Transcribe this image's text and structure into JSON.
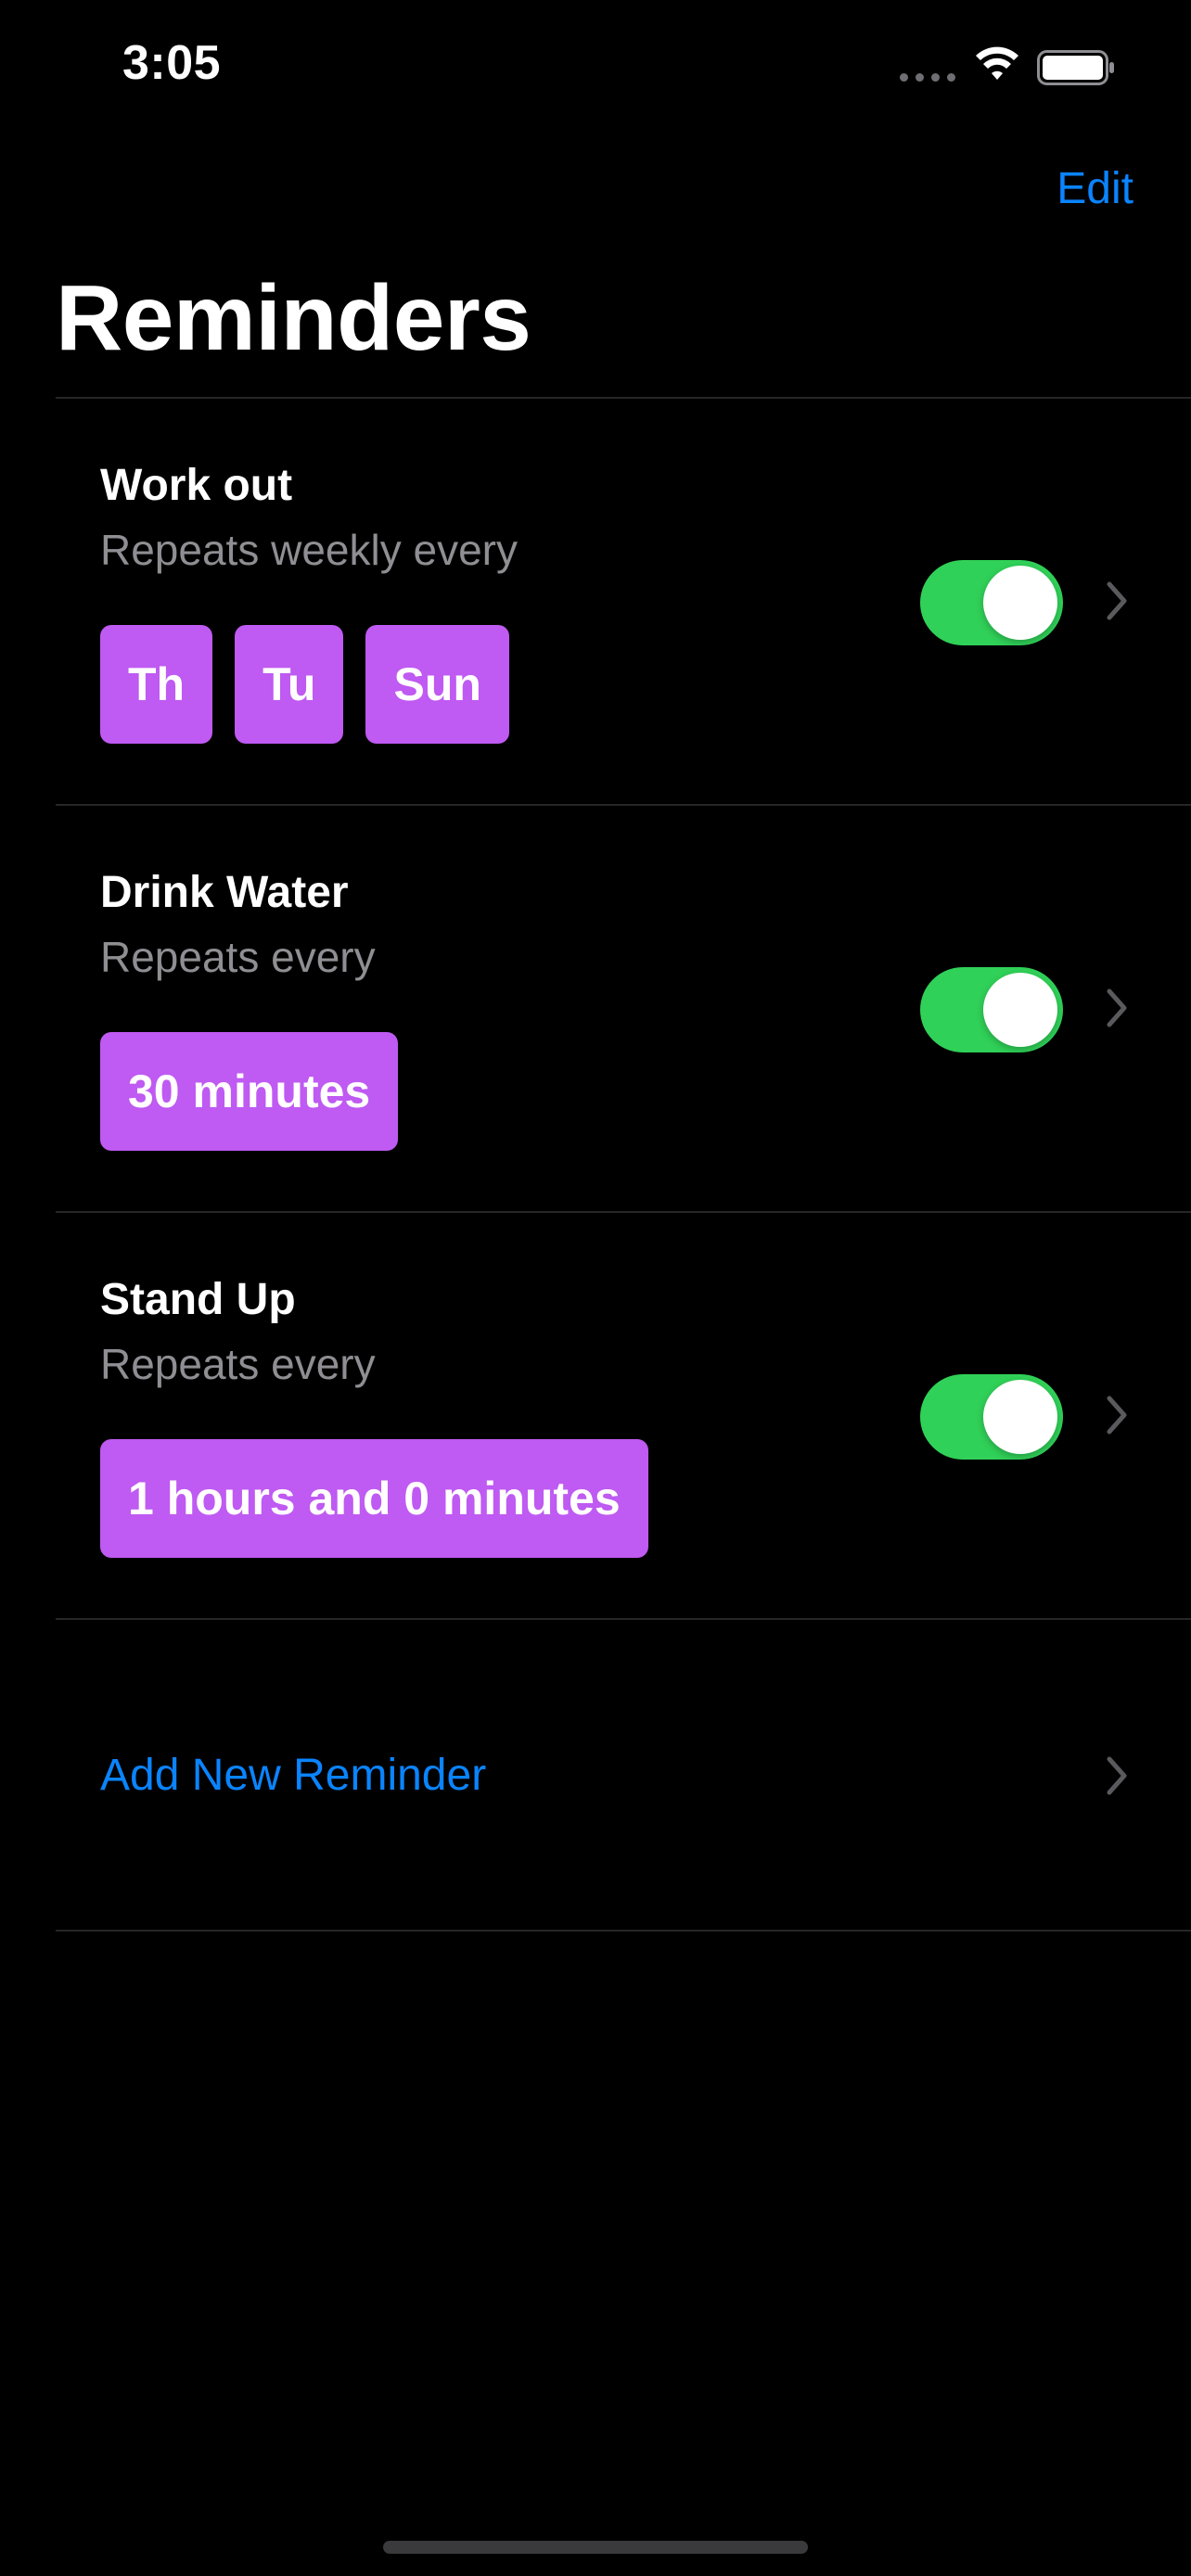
{
  "status_bar": {
    "time": "3:05",
    "signal_icon": "cellular-signal-icon",
    "wifi_icon": "wifi-icon",
    "battery_icon": "battery-icon"
  },
  "nav": {
    "edit_label": "Edit",
    "title": "Reminders"
  },
  "reminders": [
    {
      "title": "Work out",
      "subtitle": "Repeats weekly every",
      "chips": [
        "Th",
        "Tu",
        "Sun"
      ],
      "enabled": true
    },
    {
      "title": "Drink Water",
      "subtitle": "Repeats every",
      "chips": [
        "30 minutes"
      ],
      "enabled": true
    },
    {
      "title": "Stand Up",
      "subtitle": "Repeats every",
      "chips": [
        "1 hours and 0 minutes"
      ],
      "enabled": true
    }
  ],
  "add_reminder": {
    "label": "Add New Reminder"
  },
  "colors": {
    "background": "#000000",
    "accent_blue": "#0a84ff",
    "chip_purple": "#bf5af2",
    "toggle_green": "#30d158",
    "secondary_text": "#8e8e93"
  }
}
